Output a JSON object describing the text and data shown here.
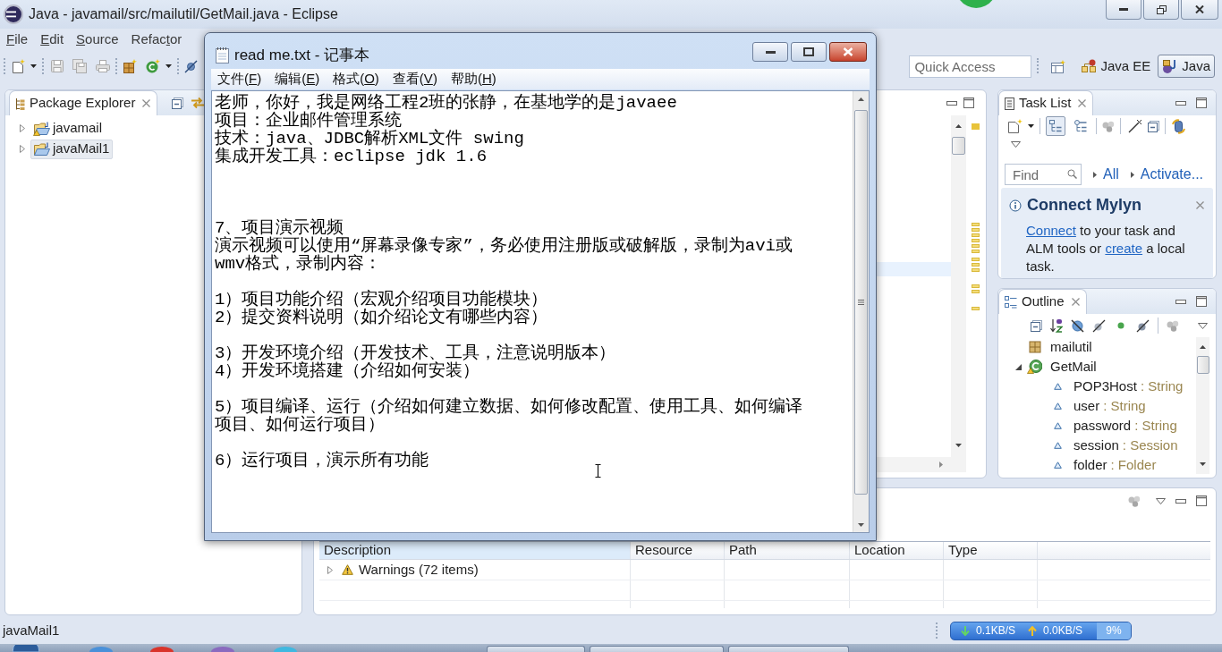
{
  "window": {
    "title": "Java - javamail/src/mailutil/GetMail.java - Eclipse"
  },
  "menu": [
    {
      "key": "F",
      "after": "ile"
    },
    {
      "key": "E",
      "after": "dit"
    },
    {
      "key": "S",
      "after": "ource"
    },
    {
      "before": "Refac",
      "key": "t",
      "after": "or"
    }
  ],
  "toolbar": {
    "quick_access": {
      "placeholder": "Quick Access"
    },
    "perspectives": [
      {
        "label": "Java EE",
        "selected": false
      },
      {
        "label": "Java",
        "selected": true
      }
    ]
  },
  "package_explorer": {
    "title": "Package Explorer",
    "items": [
      {
        "label": "javamail",
        "expanded": false,
        "selected": false,
        "warning": true
      },
      {
        "label": "javaMail1",
        "expanded": false,
        "selected": true,
        "warning": false
      }
    ]
  },
  "task_list": {
    "title": "Task List",
    "toggles": [
      {
        "kind": "categorized",
        "selected": true
      },
      {
        "kind": "scheduled",
        "selected": false
      }
    ],
    "find": {
      "placeholder": "Find"
    },
    "filters": [
      "All",
      "Activate..."
    ],
    "connect": {
      "title": "Connect Mylyn",
      "message": [
        {
          "text": "Connect",
          "link": true
        },
        {
          "text": " to your task and ALM tools or ",
          "link": false
        },
        {
          "text": "create",
          "link": true
        },
        {
          "text": " a local task.",
          "link": false
        }
      ]
    }
  },
  "outline": {
    "title": "Outline",
    "items": [
      {
        "kind": "package",
        "label": "mailutil"
      },
      {
        "kind": "class",
        "label": "GetMail",
        "expanded": true,
        "warning": true,
        "children": [
          {
            "kind": "field",
            "label": "POP3Host",
            "type": ": String"
          },
          {
            "kind": "field",
            "label": "user",
            "type": ": String"
          },
          {
            "kind": "field",
            "label": "password",
            "type": ": String"
          },
          {
            "kind": "field",
            "label": "session",
            "type": ": Session"
          },
          {
            "kind": "field",
            "label": "folder",
            "type": ": Folder"
          }
        ]
      }
    ]
  },
  "problems": {
    "columns": [
      {
        "label": "Description",
        "sorted": true
      },
      {
        "label": "Resource",
        "sorted": false
      },
      {
        "label": "Path",
        "sorted": false
      },
      {
        "label": "Location",
        "sorted": false
      },
      {
        "label": "Type",
        "sorted": false
      }
    ],
    "rows": [
      {
        "kind": "warning",
        "label": "Warnings (72 items)",
        "expanded": false
      }
    ]
  },
  "status_bar": {
    "text": "javaMail1",
    "network": {
      "download": "0.1KB/S",
      "upload": "0.0KB/S",
      "cpu": "9%"
    }
  },
  "notepad": {
    "title": "read me.txt - 记事本",
    "menu": [
      {
        "before": "文件(",
        "key": "F",
        "after": ")"
      },
      {
        "before": "编辑(",
        "key": "E",
        "after": ")"
      },
      {
        "before": "格式(",
        "key": "O",
        "after": ")"
      },
      {
        "before": "查看(",
        "key": "V",
        "after": ")"
      },
      {
        "before": "帮助(",
        "key": "H",
        "after": ")"
      }
    ],
    "lines": [
      {
        "kind": "text",
        "text": "老师，你好，我是网络工程2班的张静，在基地学的是javaee"
      },
      {
        "kind": "text",
        "text": "项目：企业邮件管理系统"
      },
      {
        "kind": "text",
        "text": "技术：java、JDBC解析XML文件 swing"
      },
      {
        "kind": "text",
        "text": "集成开发工具：eclipse jdk 1.6"
      },
      {
        "kind": "blank"
      },
      {
        "kind": "blank"
      },
      {
        "kind": "blank"
      },
      {
        "kind": "text",
        "text": "7、项目演示视频"
      },
      {
        "kind": "text",
        "text": "演示视频可以使用“屏幕录像专家”，务必使用注册版或破解版，录制为avi或"
      },
      {
        "kind": "text",
        "text": "wmv格式，录制内容："
      },
      {
        "kind": "blank"
      },
      {
        "kind": "text",
        "text": "1）项目功能介绍（宏观介绍项目功能模块）"
      },
      {
        "kind": "text",
        "text": "2）提交资料说明（如介绍论文有哪些内容）"
      },
      {
        "kind": "blank"
      },
      {
        "kind": "text",
        "text": "3）开发环境介绍（开发技术、工具，注意说明版本）"
      },
      {
        "kind": "text",
        "text": "4）开发环境搭建（介绍如何安装）"
      },
      {
        "kind": "blank"
      },
      {
        "kind": "text",
        "text": "5）项目编译、运行（介绍如何建立数据、如何修改配置、使用工具、如何编译"
      },
      {
        "kind": "text",
        "text": "项目、如何运行项目）"
      },
      {
        "kind": "blank"
      },
      {
        "kind": "text",
        "text": "6）运行项目，演示所有功能"
      }
    ]
  }
}
